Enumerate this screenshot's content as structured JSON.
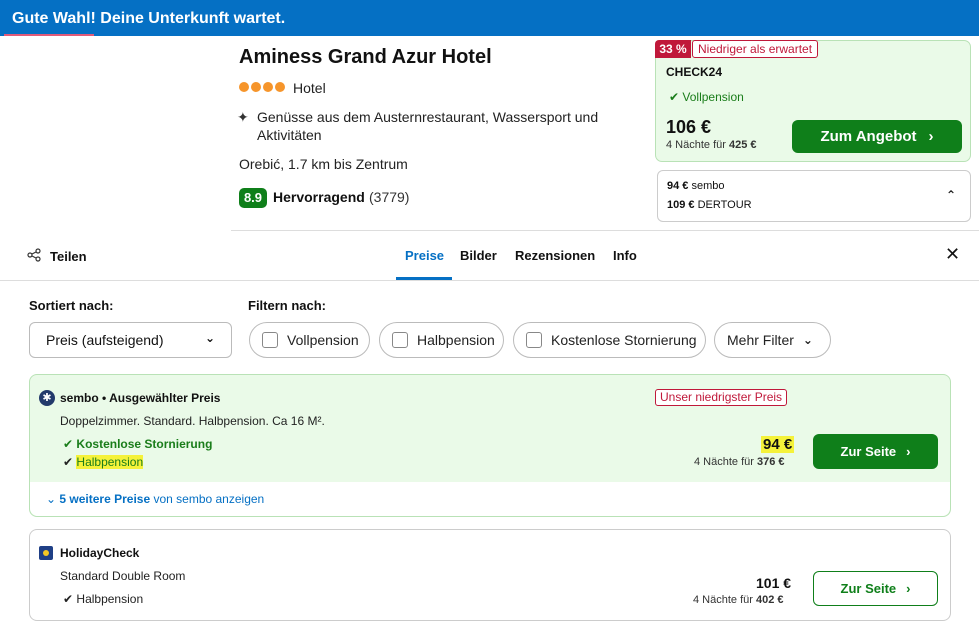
{
  "banner": {
    "text": "Gute Wahl! Deine Unterkunft wartet."
  },
  "hotel": {
    "name": "Aminess Grand Azur Hotel",
    "stars": 4,
    "type": "Hotel",
    "highlight": "Genüsse aus dem Austernrestaurant, Wassersport und Aktivitäten",
    "location": "Orebić, 1.7 km bis Zentrum",
    "rating": {
      "score": "8.9",
      "label": "Hervorragend",
      "count": "(3779)"
    }
  },
  "top_offer": {
    "discount": "33 %",
    "badge": "Niedriger als erwartet",
    "provider": "CHECK24",
    "board": "Vollpension",
    "price": "106 €",
    "nights_prefix": "4 Nächte für ",
    "nights_total": "425 €",
    "button": "Zum Angebot"
  },
  "other_offers": [
    {
      "price": "94 €",
      "provider": "sembo"
    },
    {
      "price": "109 €",
      "provider": "DERTOUR"
    }
  ],
  "toolbar": {
    "share": "Teilen",
    "tabs": [
      "Preise",
      "Bilder",
      "Rezensionen",
      "Info"
    ],
    "active_tab": "Preise"
  },
  "sort": {
    "label": "Sortiert nach:",
    "value": "Preis (aufsteigend)"
  },
  "filter": {
    "label": "Filtern nach:",
    "chips": [
      "Vollpension",
      "Halbpension",
      "Kostenlose Stornierung",
      "Mehr Filter"
    ]
  },
  "offers": [
    {
      "provider": "sembo",
      "title": "sembo • Ausgewählter Preis",
      "description": "Doppelzimmer. Standard. Halbpension. Ca 16 M².",
      "features": [
        "Kostenlose Stornierung",
        "Halbpension"
      ],
      "badge": "Unser niedrigster Preis",
      "price": "94 €",
      "nights_prefix": "4 Nächte für ",
      "nights_total": "376 €",
      "button": "Zur Seite",
      "more_link": "5 weitere Preise",
      "more_suffix": " von sembo anzeigen"
    },
    {
      "provider": "HolidayCheck",
      "title": "HolidayCheck",
      "description": "Standard Double Room",
      "features": [
        "Halbpension"
      ],
      "price": "101 €",
      "nights_prefix": "4 Nächte für ",
      "nights_total": "402 €",
      "button": "Zur Seite"
    }
  ],
  "colors": {
    "brand_blue": "#0570c4",
    "green": "#0f7f1a",
    "red": "#c0183a",
    "rating_star": "#f6952b"
  },
  "icons": [
    "sparkle-icon",
    "check-icon",
    "chevron-right-icon",
    "chevron-down-icon",
    "chevron-up-icon",
    "share-icon",
    "close-icon"
  ]
}
